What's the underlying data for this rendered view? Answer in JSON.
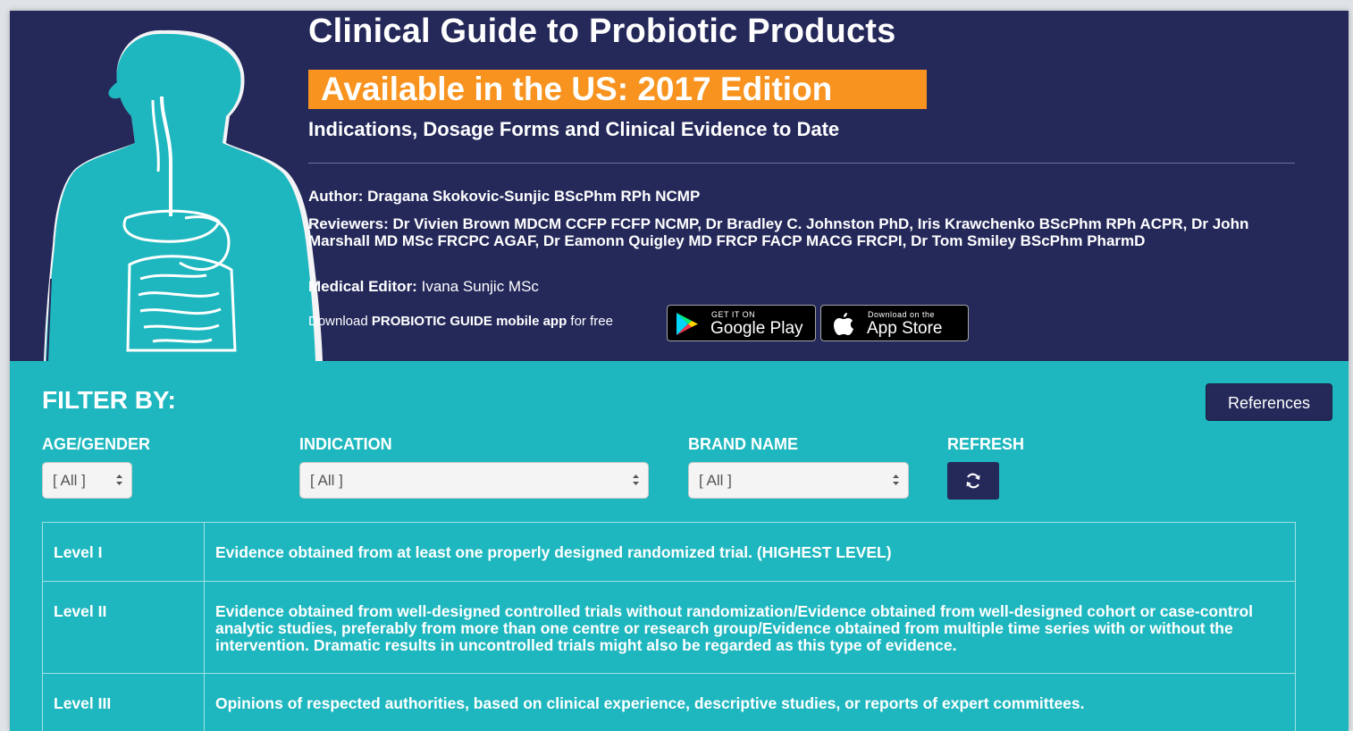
{
  "header": {
    "title": "Clinical Guide to Probiotic Products",
    "edition": "Available in the US: 2017 Edition",
    "subtitle": "Indications, Dosage Forms and Clinical Evidence to Date",
    "author_label": "Author:",
    "author": "Dragana Skokovic-Sunjic BScPhm RPh NCMP",
    "reviewers_label": "Reviewers:",
    "reviewers": "Dr Vivien Brown MDCM CCFP FCFP NCMP, Dr Bradley C. Johnston PhD, Iris Krawchenko BScPhm RPh ACPR, Dr John Marshall MD MSc FRCPC AGAF, Dr Eamonn Quigley MD FRCP FACP MACG FRCPI, Dr Tom Smiley BScPhm PharmD",
    "editor_label": "Medical Editor:",
    "editor": "Ivana Sunjic MSc",
    "download_prefix": "Download ",
    "download_app": "PROBIOTIC GUIDE mobile app",
    "download_suffix": " for free",
    "google_play_small": "GET IT ON",
    "google_play_big": "Google Play",
    "app_store_small": "Download on the",
    "app_store_big": "App Store"
  },
  "filter": {
    "title": "FILTER BY:",
    "references_label": "References",
    "age_gender_label": "AGE/GENDER",
    "age_gender_value": "[ All ]",
    "indication_label": "INDICATION",
    "indication_value": "[ All ]",
    "brand_label": "BRAND NAME",
    "brand_value": "[ All ]",
    "refresh_label": "REFRESH"
  },
  "levels": [
    {
      "level": "Level I",
      "description": "Evidence obtained from at least one properly designed randomized trial. (HIGHEST LEVEL)"
    },
    {
      "level": "Level II",
      "description": "Evidence obtained from well-designed controlled trials without randomization/Evidence obtained from well-designed cohort or case-control analytic studies, preferably from more than one centre or research group/Evidence obtained from multiple time series with or without the intervention. Dramatic results in uncontrolled trials might also be regarded as this type of evidence."
    },
    {
      "level": "Level III",
      "description": "Opinions of respected authorities, based on clinical experience, descriptive studies, or reports of expert committees."
    }
  ],
  "colors": {
    "header_bg": "#25295a",
    "accent_orange": "#f7931e",
    "teal": "#1fb7bf"
  },
  "icons": [
    "human-body-illustration",
    "google-play-icon",
    "apple-icon",
    "refresh-icon",
    "select-arrows-icon"
  ]
}
